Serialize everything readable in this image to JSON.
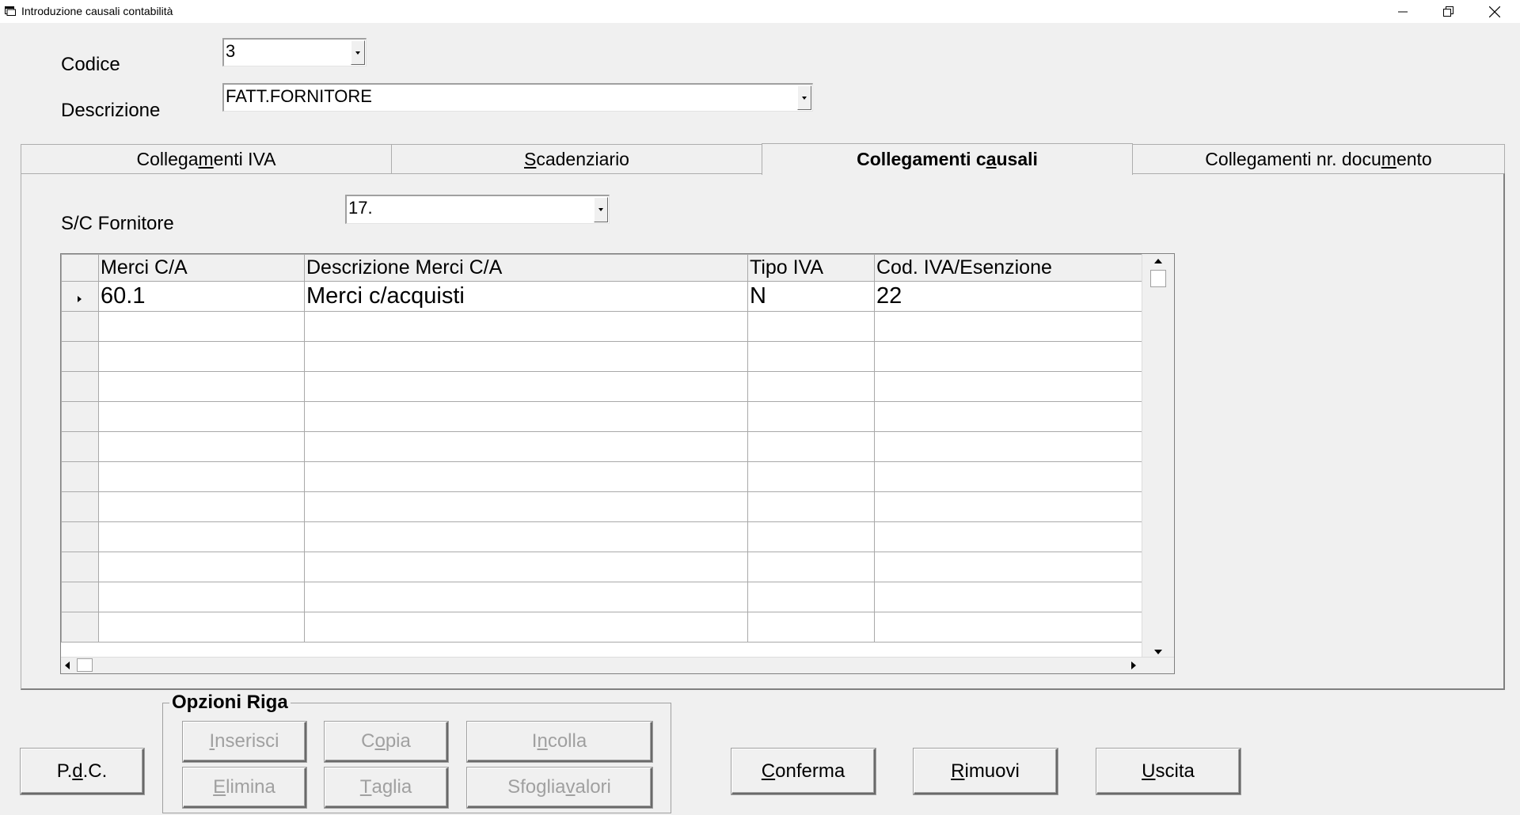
{
  "window": {
    "title": "Introduzione causali contabilità"
  },
  "form": {
    "codice_label": "Codice",
    "codice_value": "3",
    "descrizione_label": "Descrizione",
    "descrizione_value": "FATT.FORNITORE"
  },
  "tabs": [
    {
      "pre": "Collega",
      "ul": "m",
      "post": "enti IVA",
      "active": false
    },
    {
      "pre": "",
      "ul": "S",
      "post": "cadenziario",
      "active": false
    },
    {
      "pre": "Collegamenti c",
      "ul": "a",
      "post": "usali",
      "active": true
    },
    {
      "pre": "Collegamenti nr. docu",
      "ul": "m",
      "post": "ento",
      "active": false
    }
  ],
  "panel": {
    "sc_label": "S/C Fornitore",
    "sc_value": "17."
  },
  "grid": {
    "headers": [
      "Merci C/A",
      "Descrizione Merci C/A",
      "Tipo IVA",
      "Cod. IVA/Esenzione"
    ],
    "rows": [
      {
        "merci": "60.1",
        "descrizione": "Merci c/acquisti",
        "tipo_iva": "N",
        "cod_iva": "22",
        "current": true
      }
    ],
    "empty_rows": 11
  },
  "opzioni_riga": {
    "title": "Opzioni Riga",
    "inserisci": {
      "pre": "",
      "ul": "I",
      "post": "nserisci"
    },
    "copia": {
      "pre": "C",
      "ul": "o",
      "post": "pia"
    },
    "incolla": {
      "pre": "I",
      "ul": "n",
      "post": "colla"
    },
    "elimina": {
      "pre": "",
      "ul": "E",
      "post": "limina"
    },
    "taglia": {
      "pre": "",
      "ul": "T",
      "post": "aglia"
    },
    "sfoglia": {
      "pre": "Sfoglia ",
      "ul": "v",
      "post": "alori"
    }
  },
  "buttons": {
    "pdc": {
      "pre": "P.",
      "ul": "d",
      "post": ".C."
    },
    "conferma": {
      "pre": "",
      "ul": "C",
      "post": "onferma"
    },
    "rimuovi": {
      "pre": "",
      "ul": "R",
      "post": "imuovi"
    },
    "uscita": {
      "pre": "",
      "ul": "U",
      "post": "scita"
    }
  },
  "icons": {
    "app": "app-window-icon",
    "minimize": "minimize-icon",
    "restore": "restore-icon",
    "close": "close-icon",
    "dropdown": "chevron-down-icon",
    "current_row": "row-pointer-icon"
  }
}
